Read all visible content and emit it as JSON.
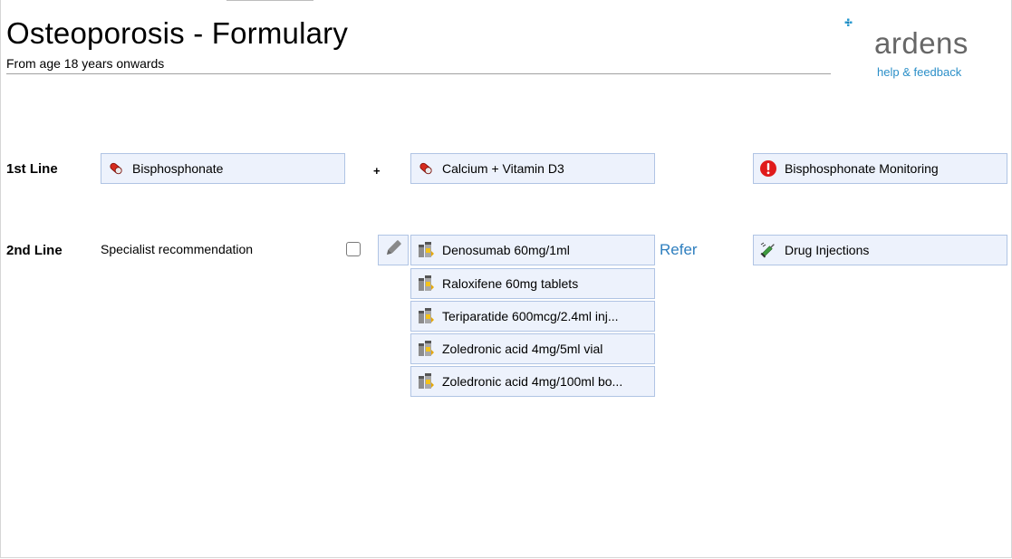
{
  "header": {
    "title": "Osteoporosis - Formulary",
    "subtitle": "From age 18 years onwards"
  },
  "logo": {
    "brand": "ardens",
    "help_link": "help & feedback",
    "accent_color": "#2a9bd0"
  },
  "first_line": {
    "label": "1st Line",
    "drugs": [
      {
        "label": "Bisphosphonate",
        "icon": "pill-icon"
      },
      {
        "label": "Calcium + Vitamin D3",
        "icon": "pill-icon"
      }
    ],
    "plus": "+",
    "monitoring": {
      "label": "Bisphosphonate Monitoring",
      "icon": "alert-icon"
    }
  },
  "second_line": {
    "label": "2nd Line",
    "note": "Specialist recommendation",
    "drugs": [
      {
        "label": "Denosumab 60mg/1ml",
        "icon": "vials-icon"
      },
      {
        "label": "Raloxifene 60mg tablets",
        "icon": "vials-icon"
      },
      {
        "label": "Teriparatide 600mcg/2.4ml inj...",
        "icon": "vials-icon"
      },
      {
        "label": "Zoledronic acid 4mg/5ml vial",
        "icon": "vials-icon"
      },
      {
        "label": "Zoledronic acid 4mg/100ml bo...",
        "icon": "vials-icon"
      }
    ],
    "refer_link": "Refer",
    "injections": {
      "label": "Drug Injections",
      "icon": "syringe-icon"
    }
  }
}
